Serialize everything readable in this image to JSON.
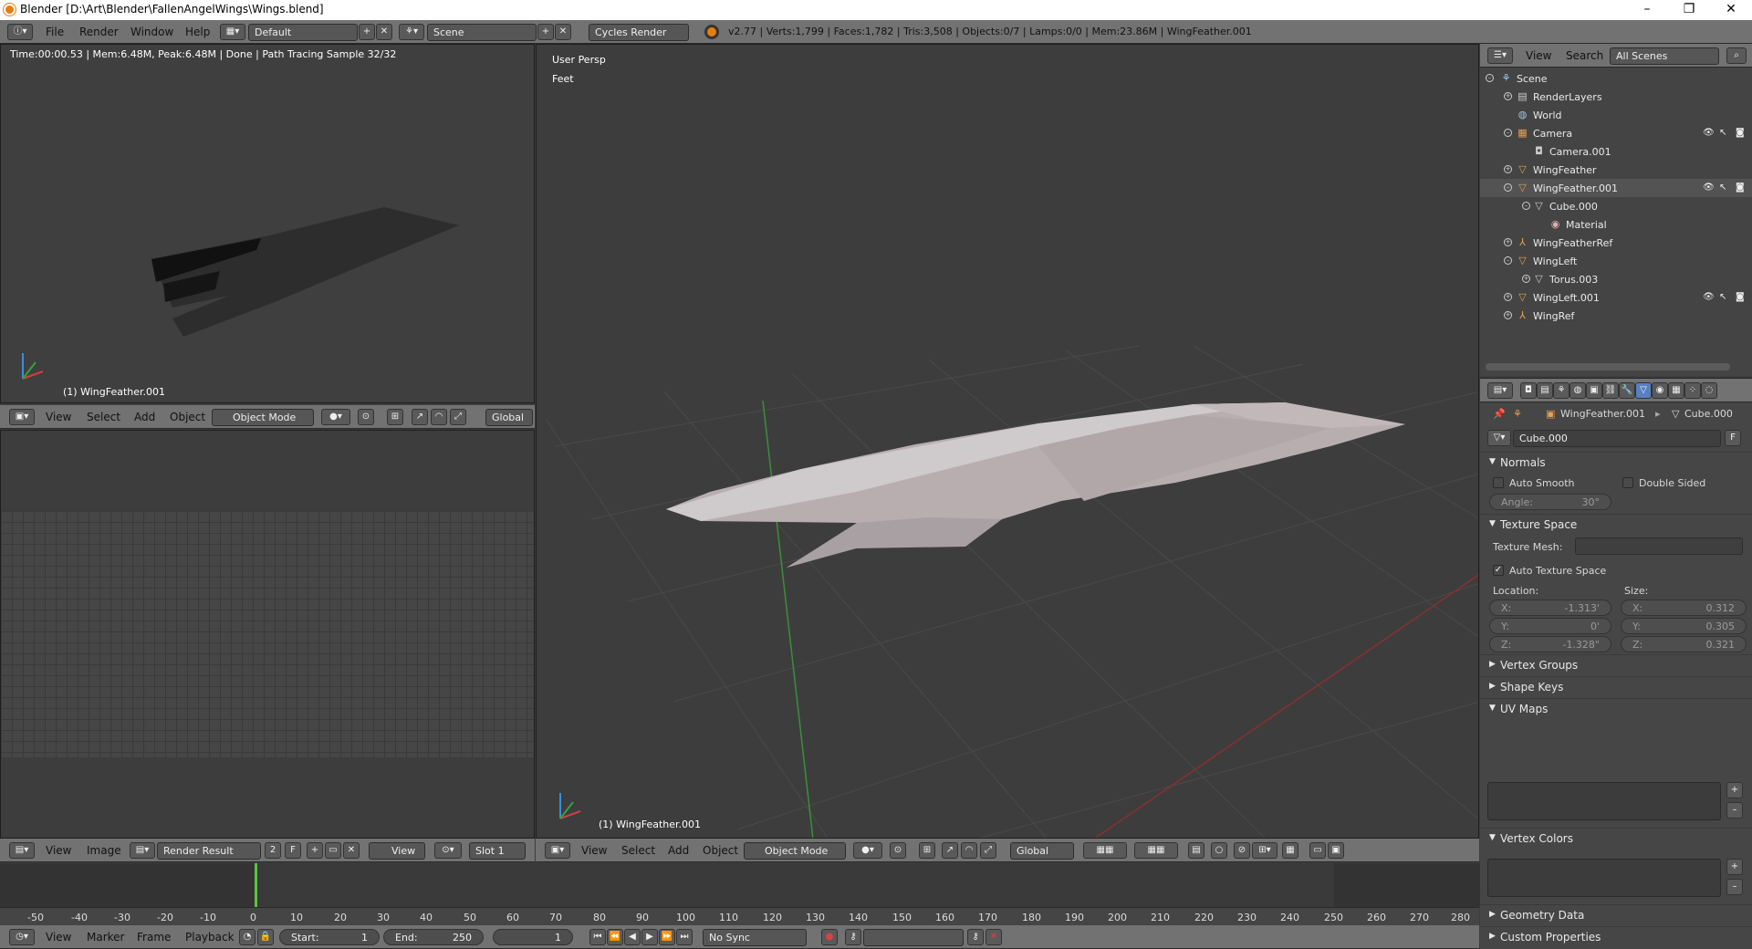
{
  "window": {
    "title": "Blender [D:\\Art\\Blender\\FallenAngelWings\\Wings.blend]",
    "controls": [
      "–",
      "❐",
      "✕"
    ]
  },
  "info_header": {
    "menus": [
      "File",
      "Render",
      "Window",
      "Help"
    ],
    "layout": "Default",
    "scene": "Scene",
    "engine": "Cycles Render",
    "stats": "v2.77 | Verts:1,799 | Faces:1,782 | Tris:3,508 | Objects:0/7 | Lamps:0/0 | Mem:23.86M | WingFeather.001"
  },
  "top_left_view": {
    "render_status": "Time:00:00.53 | Mem:6.48M, Peak:6.48M | Done | Path Tracing Sample 32/32",
    "object_label": "(1) WingFeather.001",
    "header": {
      "menus": [
        "View",
        "Select",
        "Add",
        "Object"
      ],
      "mode": "Object Mode",
      "orientation": "Global"
    }
  },
  "image_editor": {
    "header": {
      "menus": [
        "View",
        "Image"
      ],
      "image": "Render Result",
      "users": "2",
      "fake": "F",
      "view": "View",
      "slot": "Slot 1"
    }
  },
  "main_view": {
    "view_name": "User Persp",
    "units": "Feet",
    "object_label": "(1) WingFeather.001",
    "header": {
      "menus": [
        "View",
        "Select",
        "Add",
        "Object"
      ],
      "mode": "Object Mode",
      "orientation": "Global"
    }
  },
  "outliner": {
    "header": {
      "view": "View",
      "search": "Search",
      "filter": "All Scenes"
    },
    "items": [
      {
        "label": "Scene",
        "icon": "scene-icon"
      },
      {
        "label": "RenderLayers",
        "icon": "render-layers-icon"
      },
      {
        "label": "World",
        "icon": "world-icon"
      },
      {
        "label": "Camera",
        "icon": "camera-icon"
      },
      {
        "label": "Camera.001",
        "icon": "camera-data-icon"
      },
      {
        "label": "WingFeather",
        "icon": "mesh-object-icon"
      },
      {
        "label": "WingFeather.001",
        "icon": "mesh-object-icon"
      },
      {
        "label": "Cube.000",
        "icon": "mesh-data-icon"
      },
      {
        "label": "Material",
        "icon": "material-icon"
      },
      {
        "label": "WingFeatherRef",
        "icon": "empty-icon"
      },
      {
        "label": "WingLeft",
        "icon": "mesh-object-icon"
      },
      {
        "label": "Torus.003",
        "icon": "mesh-data-icon"
      },
      {
        "label": "WingLeft.001",
        "icon": "mesh-object-icon"
      },
      {
        "label": "WingRef",
        "icon": "empty-icon"
      }
    ]
  },
  "properties": {
    "breadcrumb": {
      "object": "WingFeather.001",
      "data": "Cube.000"
    },
    "mesh_name": "Cube.000",
    "fake_user": "F",
    "normals": {
      "title": "Normals",
      "auto_smooth": "Auto Smooth",
      "double_sided": "Double Sided",
      "angle_label": "Angle:",
      "angle_value": "30°"
    },
    "texture_space": {
      "title": "Texture Space",
      "texture_mesh_label": "Texture Mesh:",
      "auto_texture_space": "Auto Texture Space",
      "location_label": "Location:",
      "size_label": "Size:",
      "location": [
        {
          "axis": "X:",
          "value": "-1.313'"
        },
        {
          "axis": "Y:",
          "value": "0'"
        },
        {
          "axis": "Z:",
          "value": "-1.328\""
        }
      ],
      "size": [
        {
          "axis": "X:",
          "value": "0.312"
        },
        {
          "axis": "Y:",
          "value": "0.305"
        },
        {
          "axis": "Z:",
          "value": "0.321"
        }
      ]
    },
    "panels": {
      "vertex_groups": "Vertex Groups",
      "shape_keys": "Shape Keys",
      "uv_maps": "UV Maps",
      "vertex_colors": "Vertex Colors",
      "geometry_data": "Geometry Data",
      "custom_properties": "Custom Properties"
    }
  },
  "timeline": {
    "ticks": [
      "-50",
      "-40",
      "-30",
      "-20",
      "-10",
      "0",
      "10",
      "20",
      "30",
      "40",
      "50",
      "60",
      "70",
      "80",
      "90",
      "100",
      "110",
      "120",
      "130",
      "140",
      "150",
      "160",
      "170",
      "180",
      "190",
      "200",
      "210",
      "220",
      "230",
      "240",
      "250",
      "260",
      "270",
      "280"
    ],
    "current_frame": 1,
    "menus": [
      "View",
      "Marker",
      "Frame",
      "Playback"
    ],
    "start_label": "Start:",
    "start": "1",
    "end_label": "End:",
    "end": "250",
    "frame": "1",
    "sync": "No Sync"
  },
  "colors": {
    "accent": "#e87d0d",
    "active_frame": "#60c040",
    "x_axis": "#8b2f2f",
    "y_axis": "#3a8f3a"
  }
}
